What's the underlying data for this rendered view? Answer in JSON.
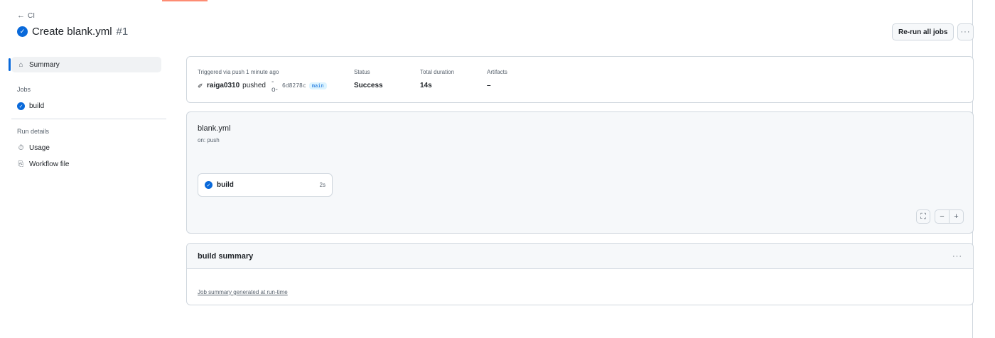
{
  "header": {
    "back_label": "CI",
    "run_title": "Create blank.yml",
    "run_number": "#1",
    "rerun_label": "Re-run all jobs",
    "more_label": "···"
  },
  "sidebar": {
    "summary_label": "Summary",
    "jobs_heading": "Jobs",
    "jobs": [
      {
        "label": "build"
      }
    ],
    "run_details_heading": "Run details",
    "usage_label": "Usage",
    "workflow_file_label": "Workflow file"
  },
  "summary": {
    "trigger_label": "Triggered via push 1 minute ago",
    "actor": "raiga0310",
    "action": "pushed",
    "commit_sha": "6d8278c",
    "branch": "main",
    "status_label": "Status",
    "status_value": "Success",
    "duration_label": "Total duration",
    "duration_value": "14s",
    "artifacts_label": "Artifacts",
    "artifacts_value": "–"
  },
  "graph": {
    "workflow_name": "blank.yml",
    "trigger": "on: push",
    "job_name": "build",
    "job_duration": "2s",
    "zoom_out": "−",
    "zoom_in": "+"
  },
  "build_summary": {
    "title": "build summary",
    "more_label": "···",
    "body_text": "Job summary generated at run-time"
  },
  "colors": {
    "accent": "#0969da",
    "tab_underline": "#fd8c73",
    "success": "#0969da"
  }
}
